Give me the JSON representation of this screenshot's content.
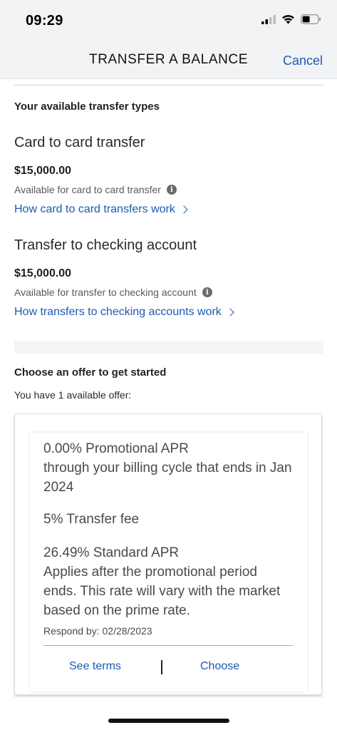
{
  "status": {
    "time": "09:29",
    "icons": [
      "cellular-signal-icon",
      "wifi-icon",
      "battery-icon"
    ]
  },
  "nav": {
    "title": "TRANSFER A BALANCE",
    "cancel_label": "Cancel"
  },
  "transfer_types": {
    "heading": "Your available transfer types",
    "items": [
      {
        "title": "Card to card transfer",
        "amount": "$15,000.00",
        "available_text": "Available for card to card transfer",
        "link_text": "How card to card transfers work"
      },
      {
        "title": "Transfer to checking account",
        "amount": "$15,000.00",
        "available_text": "Available for transfer to checking account",
        "link_text": "How transfers to checking accounts work"
      }
    ]
  },
  "offers": {
    "heading": "Choose an offer to get started",
    "count_text": "You have 1 available offer:",
    "items": [
      {
        "promo_line1": "0.00% Promotional APR",
        "promo_line2": "through your billing cycle that ends in Jan 2024",
        "fee": "5% Transfer fee",
        "standard_line1": "26.49% Standard APR",
        "standard_line2": "Applies after the promotional period ends. This rate will vary with the market based on the prime rate.",
        "respond_by": "Respond by: 02/28/2023",
        "see_terms_label": "See terms",
        "choose_label": "Choose"
      }
    ]
  },
  "colors": {
    "link_blue": "#1b5bb5",
    "header_bg": "#f2f3f4"
  }
}
